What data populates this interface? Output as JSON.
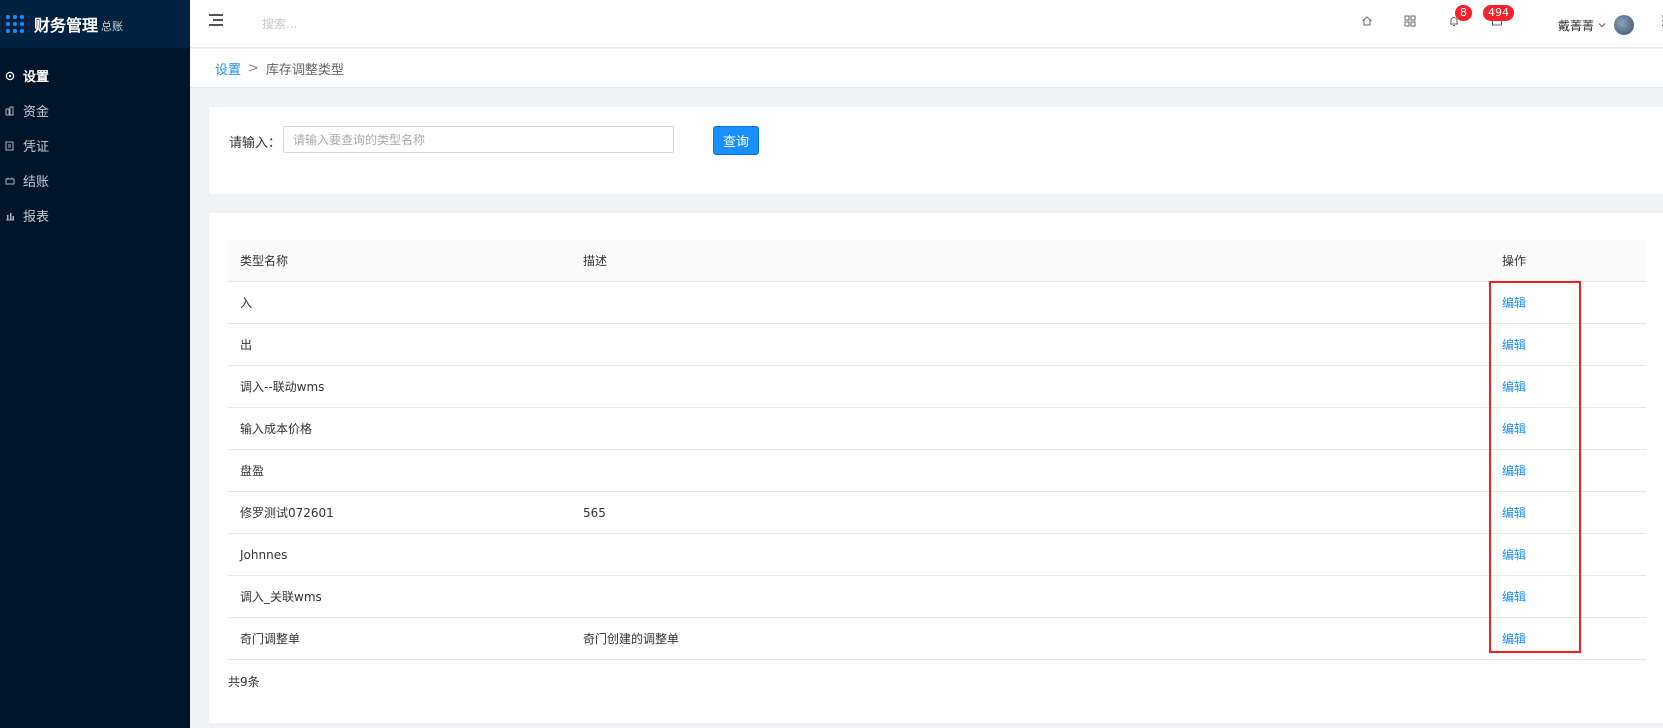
{
  "sidebar": {
    "brand_title": "财务管理",
    "brand_sub": "总账",
    "items": [
      {
        "label": "设置",
        "icon": "settings-icon",
        "active": true
      },
      {
        "label": "资金",
        "icon": "funds-icon",
        "active": false
      },
      {
        "label": "凭证",
        "icon": "voucher-icon",
        "active": false
      },
      {
        "label": "结账",
        "icon": "checkout-icon",
        "active": false
      },
      {
        "label": "报表",
        "icon": "report-chart-icon",
        "active": false
      }
    ]
  },
  "header": {
    "search_placeholder": "搜索...",
    "bell_badge": "8",
    "message_badge": "494",
    "user_name": "戴菁菁"
  },
  "breadcrumb": {
    "root": "设置",
    "separator": ">",
    "current": "库存调整类型"
  },
  "search": {
    "label": "请输入：",
    "placeholder": "请输入要查询的类型名称",
    "value": "",
    "button": "查询"
  },
  "table": {
    "columns": [
      "类型名称",
      "描述",
      "操作"
    ],
    "rows": [
      {
        "name": "入",
        "desc": "",
        "action": "编辑"
      },
      {
        "name": "出",
        "desc": "",
        "action": "编辑"
      },
      {
        "name": "调入--联动wms",
        "desc": "",
        "action": "编辑"
      },
      {
        "name": "输入成本价格",
        "desc": "",
        "action": "编辑"
      },
      {
        "name": "盘盈",
        "desc": "",
        "action": "编辑"
      },
      {
        "name": "修罗测试072601",
        "desc": "565",
        "action": "编辑"
      },
      {
        "name": "Johnnes",
        "desc": "",
        "action": "编辑"
      },
      {
        "name": "调入_关联wms",
        "desc": "",
        "action": "编辑"
      },
      {
        "name": "奇门调整单",
        "desc": "奇门创建的调整单",
        "action": "编辑"
      }
    ],
    "total": "共9条"
  },
  "colors": {
    "sidebar_bg": "#001529",
    "primary": "#1890ff",
    "highlight": "#f01f1f",
    "badge": "#f5222d"
  }
}
